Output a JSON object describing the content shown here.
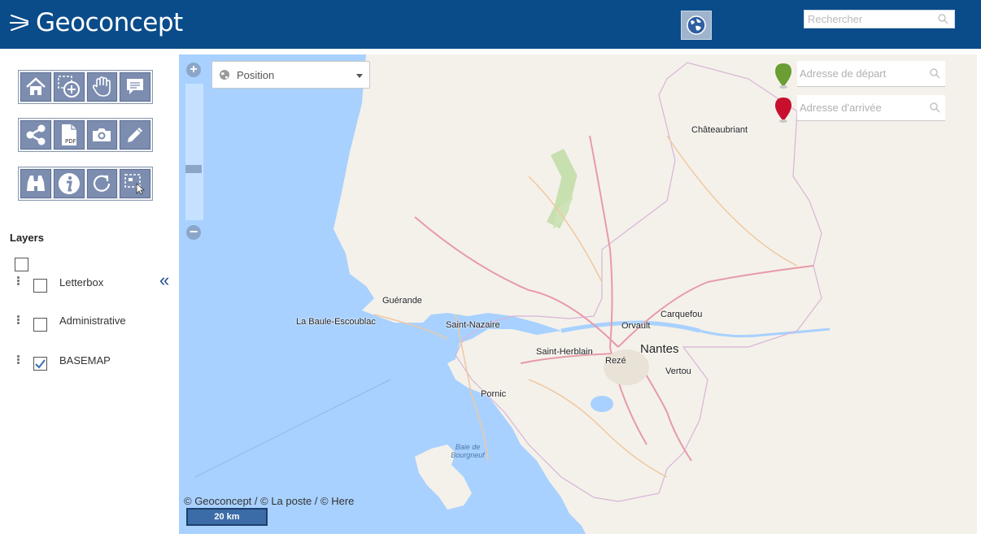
{
  "header": {
    "logo_text": "Geoconcept",
    "search_placeholder": "Rechercher",
    "globe_icon": "globe-icon"
  },
  "toolbar": {
    "row1": [
      "home-icon",
      "zoom-rectangle-icon",
      "pan-hand-icon",
      "comment-icon"
    ],
    "row2": [
      "share-icon",
      "pdf-icon",
      "camera-icon",
      "pencil-icon"
    ],
    "row3": [
      "binoculars-icon",
      "info-icon",
      "refresh-icon",
      "select-area-icon"
    ]
  },
  "layers": {
    "title": "Layers",
    "items": [
      {
        "label": "Letterbox",
        "checked": false
      },
      {
        "label": "Administrative",
        "checked": false
      },
      {
        "label": "BASEMAP",
        "checked": true
      }
    ]
  },
  "map": {
    "position_label": "Position",
    "route": {
      "start_placeholder": "Adresse de départ",
      "end_placeholder": "Adresse d'arrivée"
    },
    "cities": [
      {
        "name": "Châteaubriant"
      },
      {
        "name": "Guérande"
      },
      {
        "name": "La Baule-Escoublac"
      },
      {
        "name": "Saint-Nazaire"
      },
      {
        "name": "Carquefou"
      },
      {
        "name": "Orvault"
      },
      {
        "name": "Saint-Herblain"
      },
      {
        "name": "Nantes"
      },
      {
        "name": "Rezé"
      },
      {
        "name": "Vertou"
      },
      {
        "name": "Pornic"
      }
    ],
    "water_label": "Baie de Bourgneuf",
    "attribution": "© Geoconcept / © La poste / © Here",
    "scale": "20 km"
  },
  "colors": {
    "header": "#0a4c8a",
    "sea": "#a8d1ff",
    "land": "#f4f1ea",
    "route_start_pin": "#6a9e34",
    "route_end_pin": "#c8102e"
  }
}
